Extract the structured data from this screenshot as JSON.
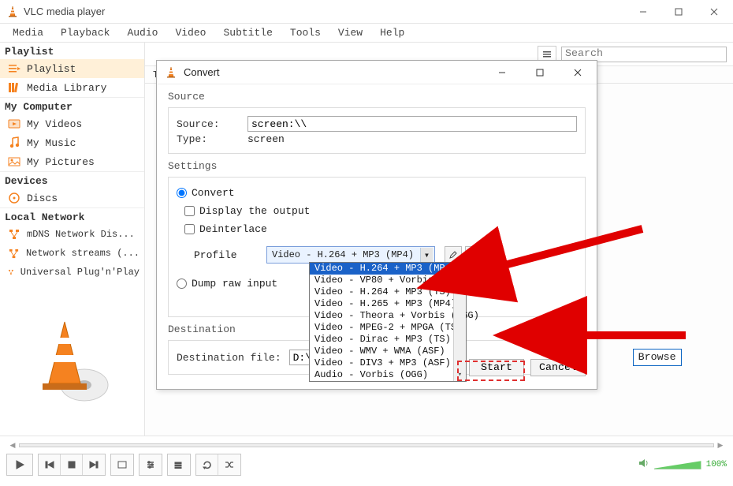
{
  "window": {
    "title": "VLC media player"
  },
  "menubar": [
    "Media",
    "Playback",
    "Audio",
    "Video",
    "Subtitle",
    "Tools",
    "View",
    "Help"
  ],
  "sidebar": {
    "header0": "Playlist",
    "items0": [
      {
        "label": "Playlist",
        "icon": "playlist"
      },
      {
        "label": "Media Library",
        "icon": "library"
      }
    ],
    "header1": "My Computer",
    "items1": [
      {
        "label": "My Videos",
        "icon": "video"
      },
      {
        "label": "My Music",
        "icon": "music"
      },
      {
        "label": "My Pictures",
        "icon": "picture"
      }
    ],
    "header2": "Devices",
    "items2": [
      {
        "label": "Discs",
        "icon": "disc"
      }
    ],
    "header3": "Local Network",
    "items3": [
      {
        "label": "mDNS Network Dis...",
        "icon": "net"
      },
      {
        "label": "Network streams (...",
        "icon": "net"
      },
      {
        "label": "Universal Plug'n'Play",
        "icon": "net"
      }
    ]
  },
  "list": {
    "header_title": "Titl",
    "search_placeholder": "Search"
  },
  "volume": {
    "percent": "100%"
  },
  "dialog": {
    "title": "Convert",
    "source_section": "Source",
    "source_label": "Source:",
    "source_value": "screen:\\\\",
    "type_label": "Type:",
    "type_value": "screen",
    "settings_section": "Settings",
    "convert_radio": "Convert",
    "display_output": "Display the output",
    "deinterlace": "Deinterlace",
    "profile_label": "Profile",
    "profile_selected": "Video - H.264 + MP3 (MP4)",
    "dump_raw": "Dump raw input",
    "dest_section": "Destination",
    "dest_label": "Destination file:",
    "dest_value": "D:\\Documen",
    "browse": "Browse",
    "start": "Start",
    "cancel": "Cancel",
    "profile_options": [
      "Video - H.264 + MP3 (MP4)",
      "Video - VP80 + Vorbis (Webm)",
      "Video - H.264 + MP3 (TS)",
      "Video - H.265 + MP3 (MP4)",
      "Video - Theora + Vorbis (OGG)",
      "Video - MPEG-2 + MPGA (TS)",
      "Video - Dirac + MP3 (TS)",
      "Video - WMV + WMA (ASF)",
      "Video - DIV3 + MP3 (ASF)",
      "Audio - Vorbis (OGG)"
    ]
  }
}
